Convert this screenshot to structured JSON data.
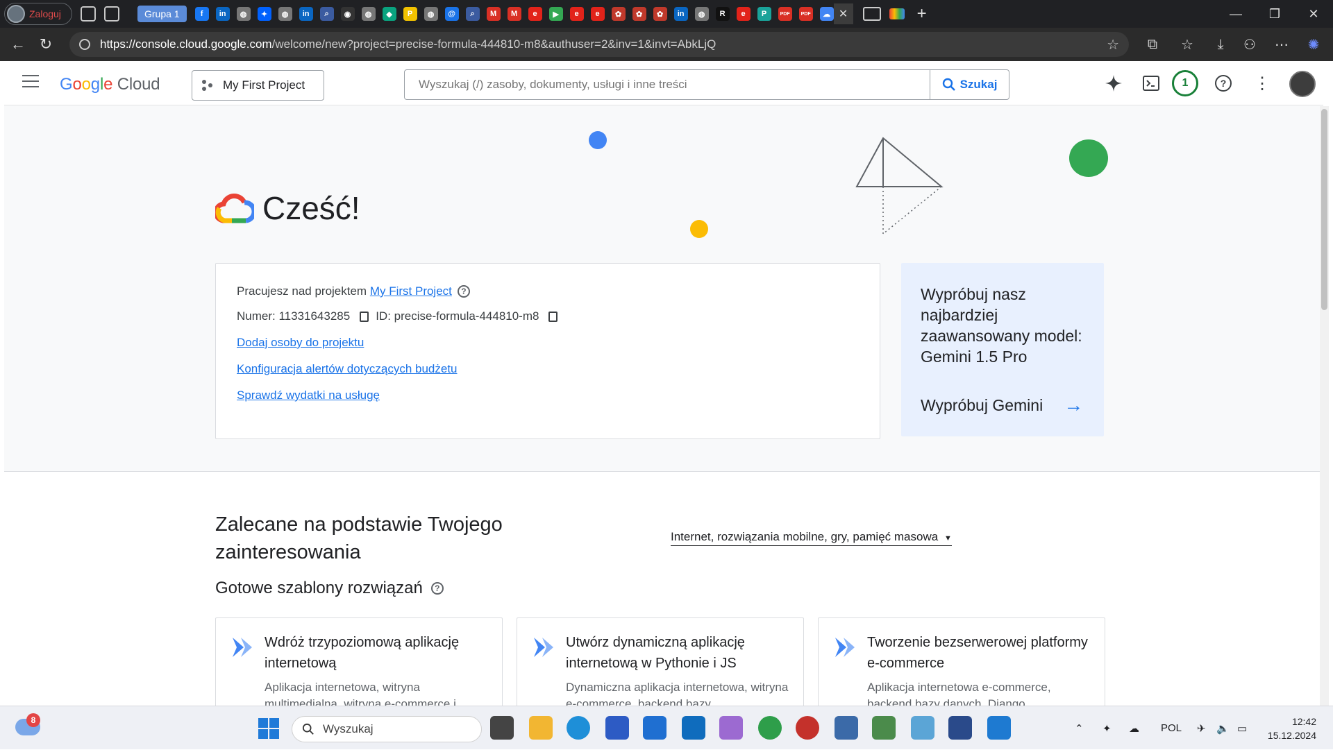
{
  "browser": {
    "profile_label": "Zaloguj",
    "tab_group_label": "Grupa 1",
    "url_host": "https://console.cloud.google.com",
    "url_path": "/welcome/new?project=precise-formula-444810-m8&authuser=2&inv=1&invt=AbkLjQ",
    "favicons": [
      {
        "name": "facebook-icon",
        "color": "#1877f2",
        "glyph": "f"
      },
      {
        "name": "linkedin-icon",
        "color": "#0a66c2",
        "glyph": "in"
      },
      {
        "name": "globe-icon",
        "color": "#777777",
        "glyph": "◍"
      },
      {
        "name": "dropbox-icon",
        "color": "#0061fe",
        "glyph": "✦"
      },
      {
        "name": "globe-icon",
        "color": "#777777",
        "glyph": "◍"
      },
      {
        "name": "linkedin-icon",
        "color": "#0a66c2",
        "glyph": "in"
      },
      {
        "name": "search-icon",
        "color": "#3b5ba0",
        "glyph": "⌕"
      },
      {
        "name": "github-icon",
        "color": "#333333",
        "glyph": "◉"
      },
      {
        "name": "globe-icon",
        "color": "#777777",
        "glyph": "◍"
      },
      {
        "name": "diamond-icon",
        "color": "#0aa37f",
        "glyph": "◆"
      },
      {
        "name": "p-icon",
        "color": "#f2c200",
        "glyph": "P"
      },
      {
        "name": "globe-icon",
        "color": "#777777",
        "glyph": "◍"
      },
      {
        "name": "at-icon",
        "color": "#1a73e8",
        "glyph": "@"
      },
      {
        "name": "search-icon",
        "color": "#3b5ba0",
        "glyph": "⌕"
      },
      {
        "name": "gmail-icon",
        "color": "#d93025",
        "glyph": "M"
      },
      {
        "name": "gmail-icon",
        "color": "#d93025",
        "glyph": "M"
      },
      {
        "name": "e-icon",
        "color": "#e2231a",
        "glyph": "e"
      },
      {
        "name": "play-icon",
        "color": "#34a853",
        "glyph": "▶"
      },
      {
        "name": "e-icon",
        "color": "#e2231a",
        "glyph": "e"
      },
      {
        "name": "e-icon",
        "color": "#e2231a",
        "glyph": "e"
      },
      {
        "name": "brain-icon",
        "color": "#c0392b",
        "glyph": "✿"
      },
      {
        "name": "brain-icon",
        "color": "#c0392b",
        "glyph": "✿"
      },
      {
        "name": "brain-icon",
        "color": "#c0392b",
        "glyph": "✿"
      },
      {
        "name": "linkedin-icon",
        "color": "#0a66c2",
        "glyph": "in"
      },
      {
        "name": "globe-icon",
        "color": "#777777",
        "glyph": "◍"
      },
      {
        "name": "r-icon",
        "color": "#111111",
        "glyph": "R"
      },
      {
        "name": "e-icon",
        "color": "#e2231a",
        "glyph": "e"
      },
      {
        "name": "teal-icon",
        "color": "#1aa39a",
        "glyph": "P"
      },
      {
        "name": "pdf-icon",
        "color": "#d93025",
        "glyph": "PDF"
      },
      {
        "name": "pdf-icon",
        "color": "#d93025",
        "glyph": "PDF"
      },
      {
        "name": "cloud-icon",
        "color": "#4285f4",
        "glyph": "☁"
      }
    ]
  },
  "header": {
    "logo_google": "Google",
    "logo_cloud": "Cloud",
    "project_button": "My First Project",
    "search_placeholder": "Wyszukaj (/) zasoby, dokumenty, usługi i inne treści",
    "search_button": "Szukaj",
    "notifications_count": "1"
  },
  "hero": {
    "greeting": "Cześć!"
  },
  "project_card": {
    "working_on_prefix": "Pracujesz nad projektem",
    "project_link": "My First Project",
    "number_label": "Numer: 11331643285",
    "id_label": "ID: precise-formula-444810-m8",
    "links": [
      "Dodaj osoby do projektu",
      "Konfiguracja alertów dotyczących budżetu",
      "Sprawdź wydatki na usługę"
    ]
  },
  "gemini_card": {
    "text": "Wypróbuj nasz najbardziej zaawansowany model: Gemini 1.5 Pro",
    "cta": "Wypróbuj Gemini"
  },
  "recommended": {
    "title": "Zalecane na podstawie Twojego zainteresowania",
    "filter": "Internet, rozwiązania mobilne, gry, pamięć masowa",
    "subtitle": "Gotowe szablony rozwiązań",
    "cards": [
      {
        "title": "Wdróż trzypoziomową aplikację internetową",
        "desc": "Aplikacja internetowa, witryna multimedialna, witryna e-commerce i"
      },
      {
        "title": "Utwórz dynamiczną aplikację internetową w Pythonie i JS",
        "desc": "Dynamiczna aplikacja internetowa, witryna e-commerce, backend bazy"
      },
      {
        "title": "Tworzenie bezserwerowej platformy e-commerce",
        "desc": "Aplikacja internetowa e-commerce, backend bazy danych, Django"
      }
    ]
  },
  "taskbar": {
    "search_placeholder": "Wyszukaj",
    "weather_badge": "8",
    "language": "POL",
    "time": "12:42",
    "date": "15.12.2024"
  },
  "colors": {
    "accent": "#1a73e8",
    "google_blue": "#4285f4",
    "google_red": "#ea4335",
    "google_yellow": "#fbbc04",
    "google_green": "#34a853",
    "gemini_bg": "#e8f0fe"
  }
}
